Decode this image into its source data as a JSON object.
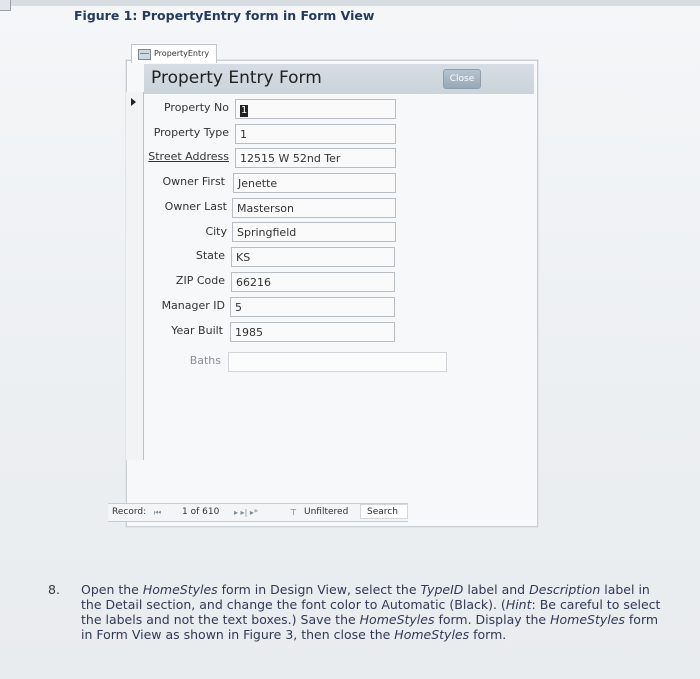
{
  "figure": {
    "caption": "Figure 1: PropertyEntry form in Form View"
  },
  "form": {
    "tab_label": "PropertyEntry",
    "title": "Property Entry Form",
    "close_label": "Close",
    "fields": [
      {
        "label": "Property No",
        "value": "1"
      },
      {
        "label": "Property Type",
        "value": "1"
      },
      {
        "label": "Street Address",
        "value": "12515 W 52nd Ter"
      },
      {
        "label": "Owner First",
        "value": "Jenette"
      },
      {
        "label": "Owner Last",
        "value": "Masterson"
      },
      {
        "label": "City",
        "value": "Springfield"
      },
      {
        "label": "State",
        "value": "KS"
      },
      {
        "label": "ZIP Code",
        "value": "66216"
      },
      {
        "label": "Manager ID",
        "value": "5"
      },
      {
        "label": "Year Built",
        "value": "1985"
      },
      {
        "label": "Baths",
        "value": ""
      }
    ]
  },
  "navigation": {
    "record_label": "Record:",
    "first_symbol": "⏮",
    "position": "1 of 610",
    "next_symbols": "▸ ▸| ▸*",
    "filter_icon": "funnel-icon",
    "filter_label": "Unfiltered",
    "search_placeholder": "Search"
  },
  "step": {
    "number": "8.",
    "parts": [
      "Open the ",
      "HomeStyles",
      " form in Design View, select the ",
      "TypeID",
      " label and ",
      "Description",
      " label in the Detail section, and change the font color to Automatic (Black). (",
      "Hint",
      ": Be careful to select the labels and not the text boxes.) Save the ",
      "HomeStyles",
      " form. Display the ",
      "HomeStyles",
      " form in Form View as shown in Figure 3, then close the ",
      "HomeStyles",
      " form."
    ]
  }
}
